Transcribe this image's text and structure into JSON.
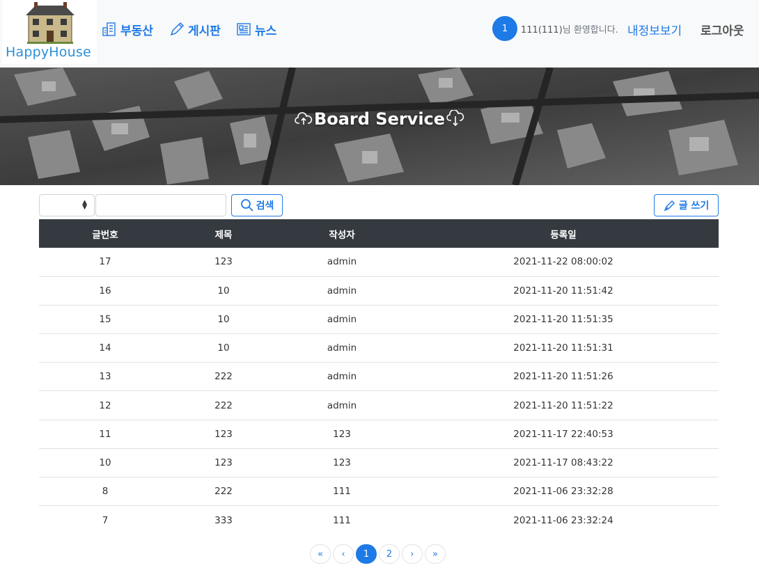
{
  "header": {
    "logo_text": "HappyHouse",
    "nav": [
      {
        "label": "부동산",
        "icon": "building-icon"
      },
      {
        "label": "게시판",
        "icon": "pencil-icon"
      },
      {
        "label": "뉴스",
        "icon": "newspaper-icon"
      }
    ],
    "user_badge": "1",
    "welcome_name": "111(111)",
    "welcome_suffix": "님 환영합니다.",
    "mypage_label": "내정보보기",
    "logout_label": "로그아웃"
  },
  "banner": {
    "title": "Board Service"
  },
  "search": {
    "select_value": "",
    "input_value": "",
    "button_label": "검색"
  },
  "write_button_label": "글 쓰기",
  "table": {
    "headers": [
      "글번호",
      "제목",
      "작성자",
      "등록일"
    ],
    "rows": [
      [
        "17",
        "123",
        "admin",
        "2021-11-22 08:00:02"
      ],
      [
        "16",
        "10",
        "admin",
        "2021-11-20 11:51:42"
      ],
      [
        "15",
        "10",
        "admin",
        "2021-11-20 11:51:35"
      ],
      [
        "14",
        "10",
        "admin",
        "2021-11-20 11:51:31"
      ],
      [
        "13",
        "222",
        "admin",
        "2021-11-20 11:51:26"
      ],
      [
        "12",
        "222",
        "admin",
        "2021-11-20 11:51:22"
      ],
      [
        "11",
        "123",
        "123",
        "2021-11-17 22:40:53"
      ],
      [
        "10",
        "123",
        "123",
        "2021-11-17 08:43:22"
      ],
      [
        "8",
        "222",
        "111",
        "2021-11-06 23:32:28"
      ],
      [
        "7",
        "333",
        "111",
        "2021-11-06 23:32:24"
      ]
    ]
  },
  "pagination": {
    "items": [
      "«",
      "‹",
      "1",
      "2",
      "›",
      "»"
    ],
    "active": "1"
  },
  "colors": {
    "accent": "#1e7ae6",
    "table_header": "#343a40",
    "header_bg": "#f8f9fa"
  }
}
